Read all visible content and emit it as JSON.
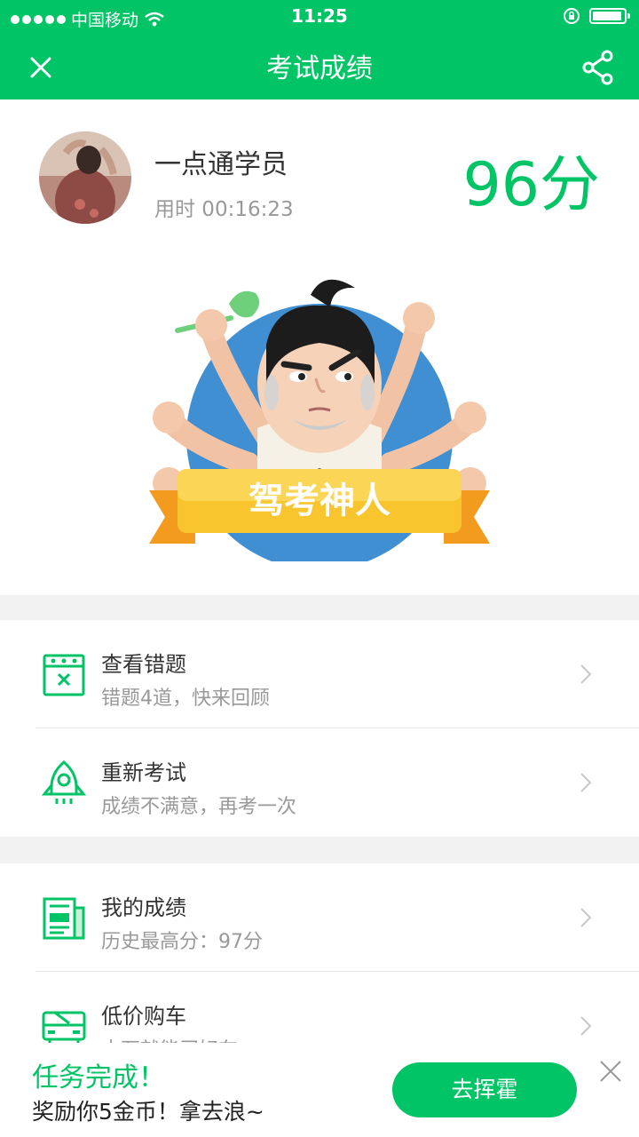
{
  "status_bar": {
    "carrier": "中国移动",
    "time": "11:25"
  },
  "nav": {
    "title": "考试成绩"
  },
  "user": {
    "name": "一点通学员",
    "time_used": "用时 00:16:23",
    "score": "96分"
  },
  "badge": {
    "label": "驾考神人"
  },
  "menu": {
    "wrong": {
      "title": "查看错题",
      "subtitle": "错题4道，快来回顾"
    },
    "retake": {
      "title": "重新考试",
      "subtitle": "成绩不满意，再考一次"
    },
    "my_score": {
      "title": "我的成绩",
      "subtitle": "历史最高分：97分"
    },
    "car": {
      "title": "低价购车",
      "subtitle": "十万就能买好车"
    }
  },
  "banner": {
    "line1": "任务完成！",
    "line2": "奖励你5金币！拿去浪~",
    "button": "去挥霍"
  },
  "colors": {
    "accent": "#00c465",
    "badge_ribbon": "#f9c52f",
    "badge_circle": "#3f8fd2"
  },
  "icons": [
    "wifi-icon",
    "lock-rotation-icon",
    "battery-icon",
    "close-icon",
    "share-icon",
    "wrong-questions-icon",
    "rocket-icon",
    "score-report-icon",
    "car-icon",
    "chevron-right-icon"
  ]
}
